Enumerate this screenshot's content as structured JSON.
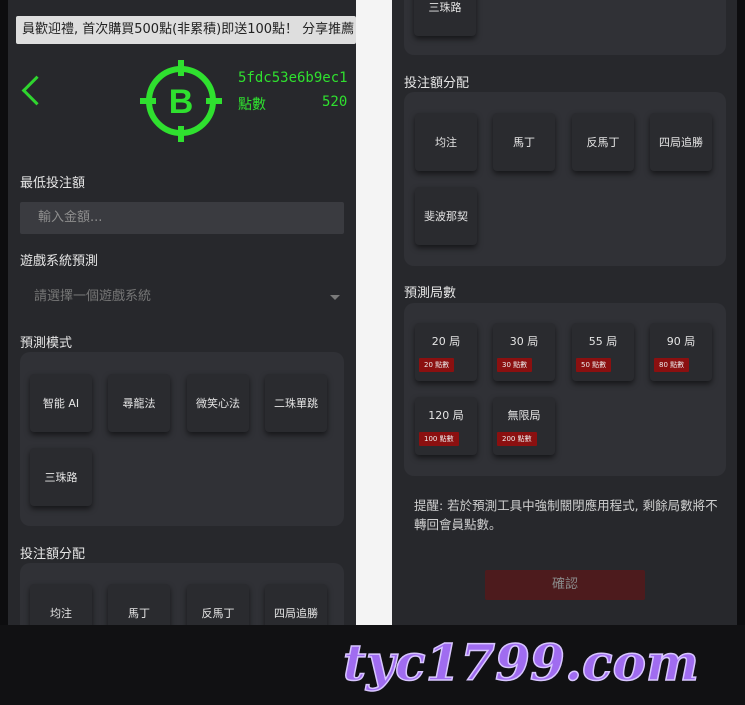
{
  "marquee": "員歡迎禮, 首次購買500點(非累積)即送100點！ 分享推薦",
  "user": {
    "id": "5fdc53e6b9ec1",
    "points_label": "點數",
    "points_value": "520"
  },
  "form": {
    "min_bet_label": "最低投注額",
    "min_bet_placeholder": "輸入金額...",
    "game_system_label": "遊戲系統預測",
    "game_system_placeholder": "請選擇一個遊戲系統",
    "mode_label": "預測模式",
    "modes": [
      "智能 AI",
      "尋龍法",
      "微笑心法",
      "二珠單跳",
      "三珠路"
    ],
    "allocation_label": "投注額分配",
    "allocations": [
      "均注",
      "馬丁",
      "反馬丁",
      "四局追勝",
      "斐波那契"
    ],
    "rounds_label": "預測局數",
    "rounds": [
      {
        "title": "20 局",
        "cost": "20 點數"
      },
      {
        "title": "30 局",
        "cost": "30 點數"
      },
      {
        "title": "55 局",
        "cost": "50 點數"
      },
      {
        "title": "90 局",
        "cost": "80 點數"
      },
      {
        "title": "120 局",
        "cost": "100 點數"
      },
      {
        "title": "無限局",
        "cost": "200 點數"
      }
    ],
    "notice": "提醒: 若於預測工具中強制關閉應用程式, 剩餘局數將不轉回會員點數。",
    "confirm": "確認"
  },
  "watermark": "tyc1799.com",
  "colors": {
    "accent_green": "#2fe02f",
    "badge_red": "#8b1010",
    "watermark_purple": "#a06cf0"
  }
}
